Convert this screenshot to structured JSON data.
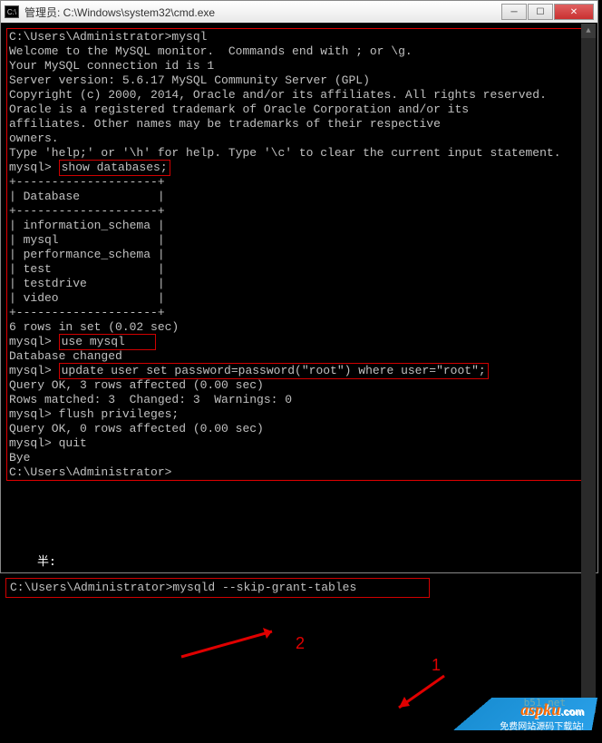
{
  "titlebar": {
    "icon_label": "C:\\",
    "title": "管理员: C:\\Windows\\system32\\cmd.exe"
  },
  "terminal": {
    "l01": "C:\\Users\\Administrator>mysql",
    "l02": "Welcome to the MySQL monitor.  Commands end with ; or \\g.",
    "l03": "Your MySQL connection id is 1",
    "l04": "Server version: 5.6.17 MySQL Community Server (GPL)",
    "blank": "",
    "l05": "Copyright (c) 2000, 2014, Oracle and/or its affiliates. All rights reserved.",
    "l06": "Oracle is a registered trademark of Oracle Corporation and/or its",
    "l07": "affiliates. Other names may be trademarks of their respective",
    "l08": "owners.",
    "l09": "Type 'help;' or '\\h' for help. Type '\\c' to clear the current input statement.",
    "p1": "mysql> ",
    "c1": "show databases;",
    "t_top": "+--------------------+",
    "t_head": "| Database           |",
    "t_r1": "| information_schema |",
    "t_r2": "| mysql              |",
    "t_r3": "| performance_schema |",
    "t_r4": "| test               |",
    "t_r5": "| testdrive          |",
    "t_r6": "| video              |",
    "l10": "6 rows in set (0.02 sec)",
    "c2": "use mysql    ",
    "l11": "Database changed",
    "c3": "update user set password=password(\"root\") where user=\"root\";",
    "l12": "Query OK, 3 rows affected (0.00 sec)",
    "l13": "Rows matched: 3  Changed: 3  Warnings: 0",
    "l14": "mysql> flush privileges;",
    "l15": "Query OK, 0 rows affected (0.00 sec)",
    "l16": "mysql> quit",
    "l17": "Bye",
    "l18": "C:\\Users\\Administrator>",
    "ime": "半:"
  },
  "bottom": {
    "cmd": "C:\\Users\\Administrator>mysqld --skip-grant-tables"
  },
  "annotations": {
    "n1": "1",
    "n2": "2"
  },
  "watermark": {
    "domain": "b51.net",
    "brand": "aspku",
    "dotcom": ".com",
    "sub": "免费网站源码下载站!"
  }
}
